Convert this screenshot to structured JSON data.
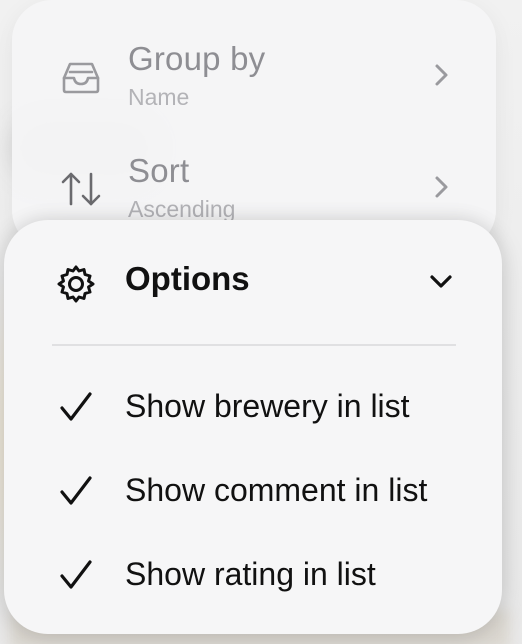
{
  "menu": {
    "group_by": {
      "label": "Group by",
      "value": "Name",
      "icon": "tray-icon"
    },
    "sort": {
      "label": "Sort",
      "value": "Ascending",
      "icon": "sort-arrows-icon"
    }
  },
  "options": {
    "title": "Options",
    "icon": "gear-icon",
    "items": [
      {
        "label": "Show brewery in list",
        "checked": true
      },
      {
        "label": "Show comment in list",
        "checked": true
      },
      {
        "label": "Show rating in list",
        "checked": true
      }
    ]
  }
}
